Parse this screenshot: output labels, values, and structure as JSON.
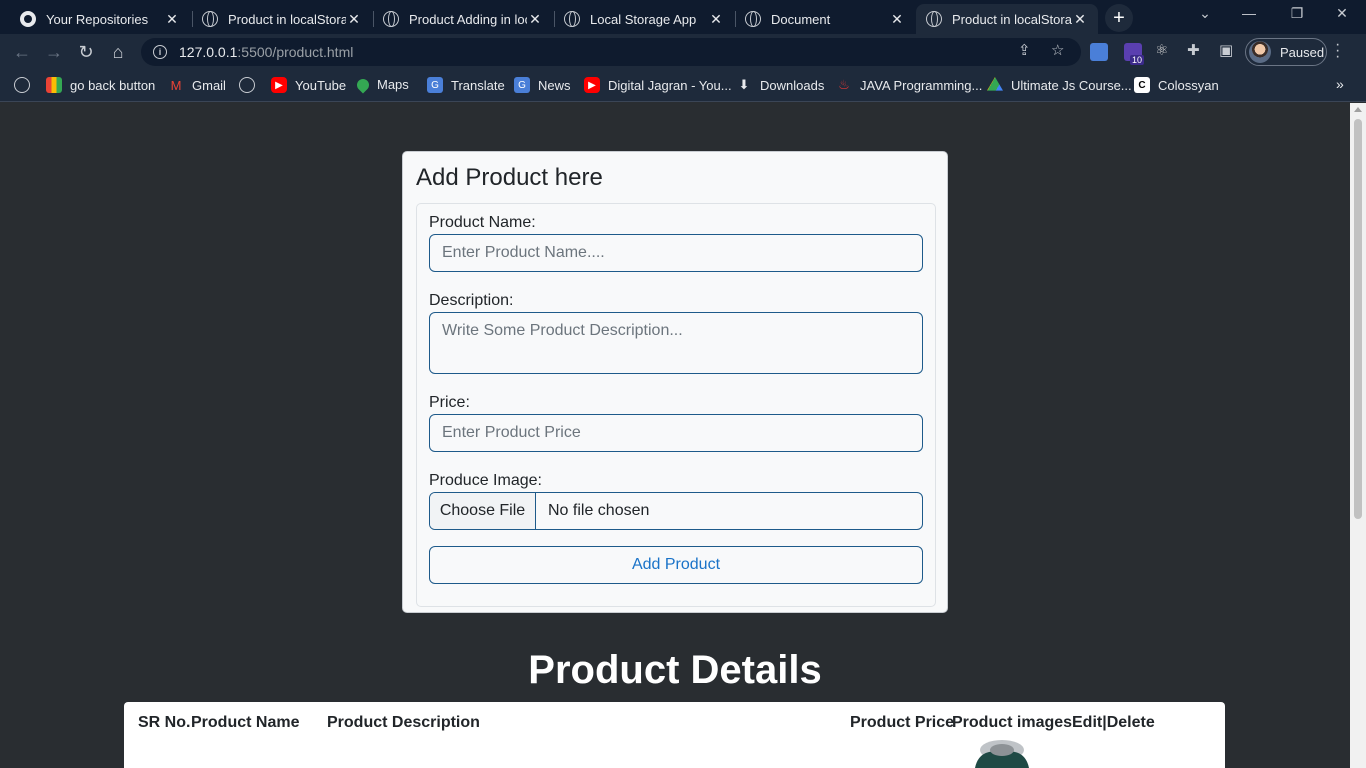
{
  "browser": {
    "tabs": [
      {
        "title": "Your Repositories",
        "icon": "github-icon",
        "active": false
      },
      {
        "title": "Product in localStorag",
        "icon": "globe-icon",
        "active": false
      },
      {
        "title": "Product Adding in loc",
        "icon": "globe-icon",
        "active": false
      },
      {
        "title": "Local Storage App",
        "icon": "globe-icon",
        "active": false
      },
      {
        "title": "Document",
        "icon": "globe-icon",
        "active": false
      },
      {
        "title": "Product in localStorag",
        "icon": "globe-icon",
        "active": true
      }
    ],
    "url_host": "127.0.0.1",
    "url_path": ":5500/product.html",
    "profile_label": "Paused",
    "extension_badge": "10",
    "bookmarks": [
      {
        "label": "go back button",
        "icon": "apps-grid-icon"
      },
      {
        "label": "Gmail",
        "icon": "gmail-icon"
      },
      {
        "label": "",
        "icon": "globe-icon"
      },
      {
        "label": "YouTube",
        "icon": "youtube-icon"
      },
      {
        "label": "Maps",
        "icon": "maps-icon"
      },
      {
        "label": "Translate",
        "icon": "translate-icon"
      },
      {
        "label": "News",
        "icon": "news-icon"
      },
      {
        "label": "Digital Jagran - You...",
        "icon": "youtube-icon"
      },
      {
        "label": "Downloads",
        "icon": "download-icon"
      },
      {
        "label": "JAVA Programming...",
        "icon": "java-icon"
      },
      {
        "label": "Ultimate Js Course...",
        "icon": "drive-icon"
      },
      {
        "label": "Colossyan",
        "icon": "colossyan-icon"
      }
    ]
  },
  "form": {
    "heading": "Add Product here",
    "name_label": "Product Name:",
    "name_placeholder": "Enter Product Name....",
    "description_label": "Description:",
    "description_placeholder": "Write Some Product Description...",
    "price_label": "Price:",
    "price_placeholder": "Enter Product Price",
    "image_label": "Produce Image:",
    "choose_file_label": "Choose File",
    "no_file_label": "No file chosen",
    "submit_label": "Add Product"
  },
  "details": {
    "title": "Product Details",
    "columns": [
      "SR No.",
      "Product Name",
      "Product Description",
      "Product Price",
      "Product images",
      "Edit|Delete"
    ]
  },
  "colors": {
    "page_bg": "#292d31",
    "accent": "#1a73c8",
    "field_border": "#1e5a8a"
  }
}
